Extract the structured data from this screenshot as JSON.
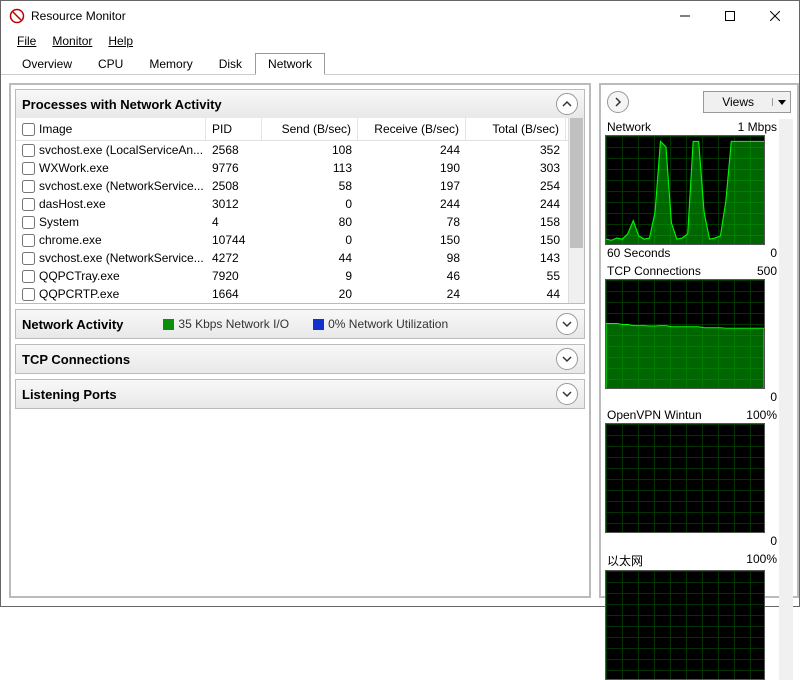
{
  "window": {
    "title": "Resource Monitor"
  },
  "menu": {
    "file": "File",
    "monitor": "Monitor",
    "help": "Help"
  },
  "tabs": {
    "overview": "Overview",
    "cpu": "CPU",
    "memory": "Memory",
    "disk": "Disk",
    "network": "Network"
  },
  "sections": {
    "processes": {
      "title": "Processes with Network Activity",
      "cols": {
        "image": "Image",
        "pid": "PID",
        "send": "Send (B/sec)",
        "receive": "Receive (B/sec)",
        "total": "Total (B/sec)"
      },
      "rows": [
        {
          "image": "svchost.exe (LocalServiceAn...",
          "pid": "2568",
          "send": "108",
          "receive": "244",
          "total": "352"
        },
        {
          "image": "WXWork.exe",
          "pid": "9776",
          "send": "113",
          "receive": "190",
          "total": "303"
        },
        {
          "image": "svchost.exe (NetworkService...",
          "pid": "2508",
          "send": "58",
          "receive": "197",
          "total": "254"
        },
        {
          "image": "dasHost.exe",
          "pid": "3012",
          "send": "0",
          "receive": "244",
          "total": "244"
        },
        {
          "image": "System",
          "pid": "4",
          "send": "80",
          "receive": "78",
          "total": "158"
        },
        {
          "image": "chrome.exe",
          "pid": "10744",
          "send": "0",
          "receive": "150",
          "total": "150"
        },
        {
          "image": "svchost.exe (NetworkService...",
          "pid": "4272",
          "send": "44",
          "receive": "98",
          "total": "143"
        },
        {
          "image": "QQPCTray.exe",
          "pid": "7920",
          "send": "9",
          "receive": "46",
          "total": "55"
        },
        {
          "image": "QQPCRTP.exe",
          "pid": "1664",
          "send": "20",
          "receive": "24",
          "total": "44"
        }
      ]
    },
    "netactivity": {
      "title": "Network Activity",
      "io_label": "35 Kbps Network I/O",
      "util_label": "0% Network Utilization"
    },
    "tcp": {
      "title": "TCP Connections"
    },
    "listening": {
      "title": "Listening Ports"
    }
  },
  "rightpanel": {
    "views_label": "Views",
    "charts": [
      {
        "title": "Network",
        "max": "1 Mbps",
        "bot_left": "60 Seconds",
        "bot_right": "0"
      },
      {
        "title": "TCP Connections",
        "max": "500",
        "bot_left": "",
        "bot_right": "0"
      },
      {
        "title": "OpenVPN Wintun",
        "max": "100%",
        "bot_left": "",
        "bot_right": "0"
      },
      {
        "title": "以太网",
        "max": "100%",
        "bot_left": "",
        "bot_right": ""
      }
    ]
  },
  "chart_data": [
    {
      "type": "line",
      "title": "Network",
      "ylabel": "",
      "ylim": [
        0,
        1
      ],
      "y_unit": "Mbps",
      "x_seconds": 60,
      "values": [
        0.05,
        0.04,
        0.06,
        0.05,
        0.1,
        0.22,
        0.08,
        0.05,
        0.06,
        0.3,
        0.95,
        0.9,
        0.2,
        0.05,
        0.06,
        0.1,
        0.95,
        0.95,
        0.3,
        0.05,
        0.06,
        0.08,
        0.4,
        0.95,
        0.95,
        0.95,
        0.95,
        0.95,
        0.95,
        0.95
      ]
    },
    {
      "type": "area",
      "title": "TCP Connections",
      "ylabel": "",
      "ylim": [
        0,
        500
      ],
      "x_seconds": 60,
      "values": [
        300,
        300,
        300,
        295,
        295,
        290,
        290,
        290,
        288,
        288,
        290,
        290,
        285,
        285,
        285,
        285,
        285,
        285,
        280,
        280,
        280,
        280,
        278,
        278,
        278,
        278,
        278,
        278,
        278,
        278
      ]
    },
    {
      "type": "line",
      "title": "OpenVPN Wintun",
      "ylabel": "",
      "ylim": [
        0,
        100
      ],
      "y_unit": "%",
      "x_seconds": 60,
      "values": [
        0,
        0,
        0,
        0,
        0,
        0,
        0,
        0,
        0,
        0,
        0,
        0,
        0,
        0,
        0,
        0,
        0,
        0,
        0,
        0,
        0,
        0,
        0,
        0,
        0,
        0,
        0,
        0,
        0,
        0
      ]
    },
    {
      "type": "line",
      "title": "以太网",
      "ylabel": "",
      "ylim": [
        0,
        100
      ],
      "y_unit": "%",
      "x_seconds": 60,
      "values": [
        0,
        0,
        0,
        0,
        0,
        0,
        0,
        0,
        0,
        0,
        0,
        0,
        0,
        0,
        0,
        0,
        0,
        0,
        0,
        0,
        0,
        0,
        0,
        0,
        0,
        0,
        0,
        0,
        0,
        0
      ]
    }
  ]
}
